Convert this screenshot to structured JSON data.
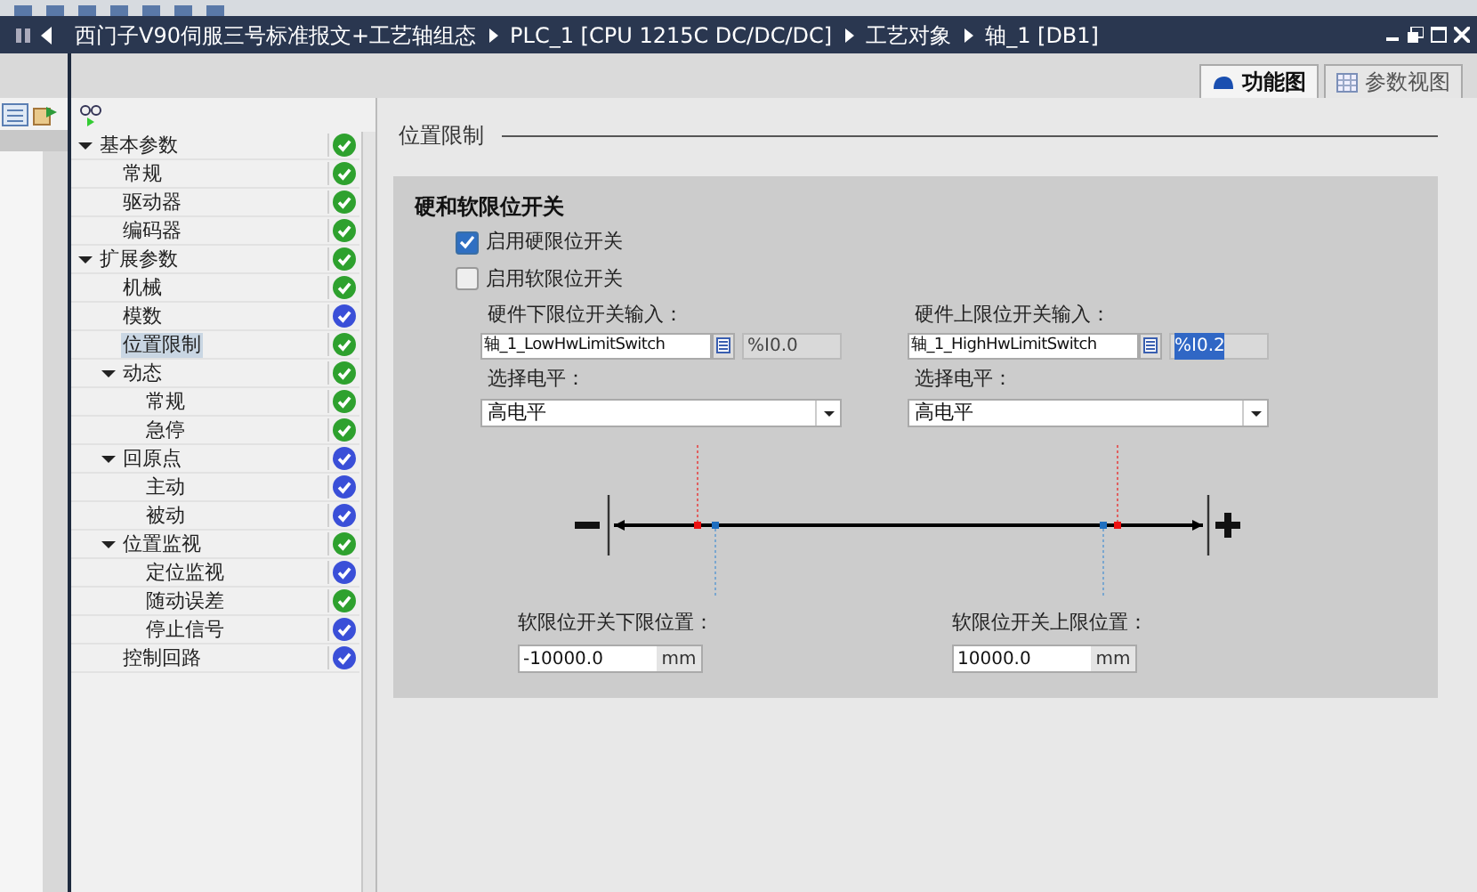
{
  "breadcrumb": [
    "西门子V90伺服三号标准报文+工艺轴组态",
    "PLC_1 [CPU 1215C DC/DC/DC]",
    "工艺对象",
    "轴_1 [DB1]"
  ],
  "view_tabs": [
    {
      "label": "功能图",
      "selected": true
    },
    {
      "label": "参数视图",
      "selected": false
    }
  ],
  "nav_tree": [
    {
      "label": "基本参数",
      "expanded": true,
      "selected": false,
      "color": "#2ea12e",
      "children": [
        {
          "label": "常规",
          "selected": false,
          "color": "#2ea12e"
        },
        {
          "label": "驱动器",
          "selected": false,
          "color": "#2ea12e"
        },
        {
          "label": "编码器",
          "selected": false,
          "color": "#2ea12e"
        }
      ]
    },
    {
      "label": "扩展参数",
      "expanded": true,
      "selected": false,
      "color": "#2ea12e",
      "children": [
        {
          "label": "机械",
          "selected": false,
          "color": "#2ea12e"
        },
        {
          "label": "模数",
          "selected": false,
          "color": "#3a4fd8"
        },
        {
          "label": "位置限制",
          "selected": true,
          "color": "#2ea12e"
        },
        {
          "label": "动态",
          "expanded": true,
          "selected": false,
          "color": "#2ea12e",
          "children": [
            {
              "label": "常规",
              "selected": false,
              "color": "#2ea12e"
            },
            {
              "label": "急停",
              "selected": false,
              "color": "#2ea12e"
            }
          ]
        },
        {
          "label": "回原点",
          "expanded": true,
          "selected": false,
          "color": "#3a4fd8",
          "children": [
            {
              "label": "主动",
              "selected": false,
              "color": "#3a4fd8"
            },
            {
              "label": "被动",
              "selected": false,
              "color": "#3a4fd8"
            }
          ]
        },
        {
          "label": "位置监视",
          "expanded": true,
          "selected": false,
          "color": "#2ea12e",
          "children": [
            {
              "label": "定位监视",
              "selected": false,
              "color": "#3a4fd8"
            },
            {
              "label": "随动误差",
              "selected": false,
              "color": "#2ea12e"
            },
            {
              "label": "停止信号",
              "selected": false,
              "color": "#3a4fd8"
            }
          ]
        },
        {
          "label": "控制回路",
          "selected": false,
          "color": "#3a4fd8"
        }
      ]
    }
  ],
  "section_title": "位置限制",
  "group": {
    "title": "硬和软限位开关",
    "options": [
      {
        "label": "启用硬限位开关",
        "checked": true
      },
      {
        "label": "启用软限位开关",
        "checked": false
      }
    ],
    "hw_inputs": [
      {
        "label": "硬件下限位开关输入：",
        "tag": "轴_1_LowHwLimitSwitch",
        "address": "%I0.0",
        "address_selected": false,
        "level_label": "选择电平：",
        "level_value": "高电平"
      },
      {
        "label": "硬件上限位开关输入：",
        "tag": "轴_1_HighHwLimitSwitch",
        "address": "%I0.2",
        "address_selected": true,
        "level_label": "选择电平：",
        "level_value": "高电平"
      }
    ],
    "soft_limits": [
      {
        "label": "软限位开关下限位置：",
        "value": "-10000.0",
        "unit": "mm"
      },
      {
        "label": "软限位开关上限位置：",
        "value": "10000.0",
        "unit": "mm"
      }
    ]
  }
}
